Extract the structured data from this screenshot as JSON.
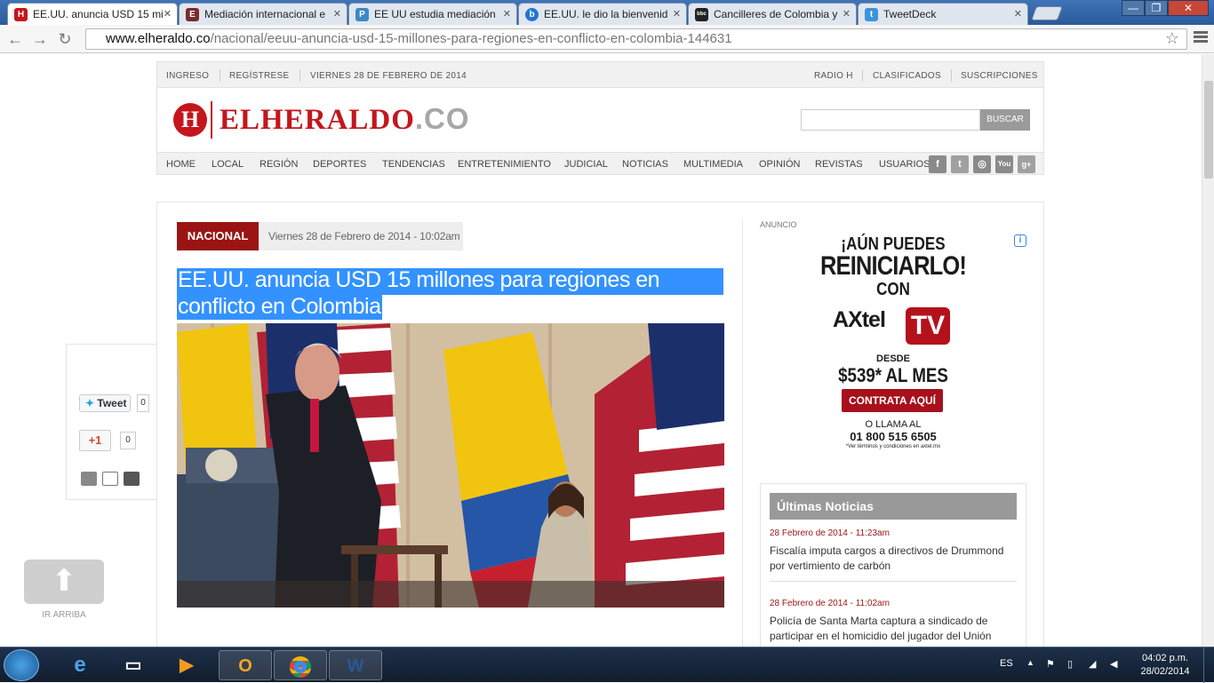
{
  "browser": {
    "tabs": [
      {
        "title": "EE.UU. anuncia USD 15 mi",
        "favicon": "H",
        "color": "#c4161c",
        "active": true
      },
      {
        "title": "Mediación internacional e",
        "favicon": "E",
        "color": "#7a2a2a",
        "active": false
      },
      {
        "title": "EE UU estudia mediación",
        "favicon": "P",
        "color": "#3a88c8",
        "active": false
      },
      {
        "title": "EE.UU. le dio la bienvenid",
        "favicon": "b",
        "color": "#2277cc",
        "active": false
      },
      {
        "title": "Cancilleres de Colombia y",
        "favicon": "bbc",
        "color": "#222222",
        "active": false
      },
      {
        "title": "TweetDeck",
        "favicon": "t",
        "color": "#3b94d9",
        "active": false
      }
    ],
    "url_host": "www.elheraldo.co",
    "url_path": "/nacional/eeuu-anuncia-usd-15-millones-para-regiones-en-conflicto-en-colombia-144631"
  },
  "topbar": {
    "ingreso": "INGRESO",
    "registrese": "REGÍSTRESE",
    "date": "VIERNES 28 DE FEBRERO DE 2014",
    "radio": "RADIO H",
    "clasificados": "CLASIFICADOS",
    "suscripciones": "SUSCRIPCIONES"
  },
  "header": {
    "logo_letter": "H",
    "logo_name": "ELHERALDO",
    "logo_suffix": ".CO",
    "search_button": "BUSCAR",
    "search_value": ""
  },
  "nav": [
    "HOME",
    "LOCAL",
    "REGIÓN",
    "DEPORTES",
    "TENDENCIAS",
    "ENTRETENIMIENTO",
    "JUDICIAL",
    "NOTICIAS",
    "MULTIMEDIA",
    "OPINIÓN",
    "REVISTAS",
    "USUARIOS"
  ],
  "social_icons": [
    "facebook-icon",
    "twitter-icon",
    "instagram-icon",
    "youtube-icon",
    "google-plus-icon"
  ],
  "article": {
    "section": "NACIONAL",
    "date": "Viernes 28 de Febrero de 2014 - 10:02am",
    "headline_line1": "EE.UU. anuncia USD 15 millones para regiones en",
    "headline_line2": "conflicto en Colombia"
  },
  "share": {
    "tweet_label": "Tweet",
    "tweet_count": "0",
    "gplus_label": "+1",
    "gplus_count": "0"
  },
  "back_to_top": "IR ARRIBA",
  "ad": {
    "label": "ANUNCIO",
    "line1": "¡AÚN PUEDES",
    "line2": "REINICIARLO!",
    "line3": "CON",
    "brand": "AXtel",
    "brand_tv": "TV",
    "from": "DESDE",
    "price": "$539* AL MES",
    "cta": "CONTRATA AQUÍ",
    "call": "O LLAMA AL",
    "phone": "01 800 515 6505",
    "terms": "*Ver términos y condiciones en axtel.mx"
  },
  "latest": {
    "title": "Últimas Noticias",
    "items": [
      {
        "date": "28 Febrero de 2014 - 11:23am",
        "text": "Fiscalía imputa cargos a directivos de Drummond por vertimiento de carbón"
      },
      {
        "date": "28 Febrero de 2014 - 11:02am",
        "text": "Policía de Santa Marta captura a sindicado de participar en el homicidio del jugador del Unión"
      }
    ]
  },
  "taskbar": {
    "lang": "ES",
    "time": "04:02 p.m.",
    "date": "28/02/2014"
  }
}
